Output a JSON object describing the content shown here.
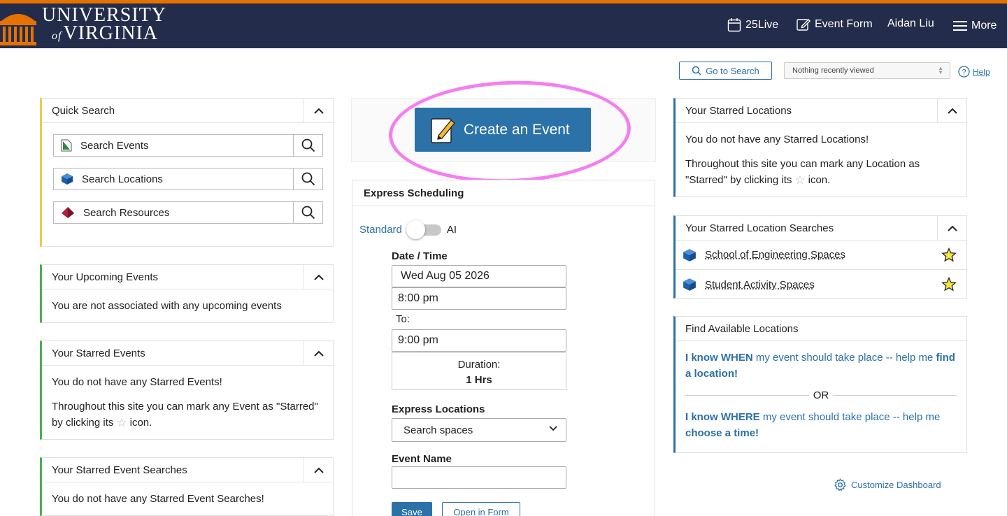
{
  "header": {
    "logo_line1": "UNIVERSITY",
    "logo_of": "of",
    "logo_line2": "VIRGINIA",
    "nav": {
      "live_label": "25Live",
      "event_form_label": "Event Form",
      "user_name": "Aidan Liu",
      "more_label": "More"
    }
  },
  "utility": {
    "go_to_search": "Go to Search",
    "recently_viewed": "Nothing recently viewed",
    "help": "Help"
  },
  "quick_search": {
    "title": "Quick Search",
    "items": [
      {
        "label": "Search Events"
      },
      {
        "label": "Search Locations"
      },
      {
        "label": "Search Resources"
      }
    ]
  },
  "upcoming_events": {
    "title": "Your Upcoming Events",
    "message": "You are not associated with any upcoming events"
  },
  "starred_events": {
    "title": "Your Starred Events",
    "message": "You do not have any Starred Events!",
    "hint_before": "Throughout this site you can mark any Event as \"Starred\" by clicking its",
    "hint_after": "icon."
  },
  "starred_event_searches": {
    "title": "Your Starred Event Searches",
    "message": "You do not have any Starred Event Searches!"
  },
  "create_event": {
    "label": "Create an Event"
  },
  "express": {
    "title": "Express Scheduling",
    "toggle_left": "Standard",
    "toggle_right": "AI",
    "toggle_on": false,
    "date_time_label": "Date / Time",
    "date": "Wed Aug 05 2026",
    "start_time": "8:00 pm",
    "to_label": "To:",
    "end_time": "9:00 pm",
    "duration_label": "Duration:",
    "duration_value": "1 Hrs",
    "locations_label": "Express Locations",
    "locations_value": "Search spaces",
    "event_name_label": "Event Name",
    "event_name_value": "",
    "save": "Save",
    "open_in_form": "Open in Form"
  },
  "starred_locations": {
    "title": "Your Starred Locations",
    "message": "You do not have any Starred Locations!",
    "hint_before": "Throughout this site you can mark any Location as \"Starred\" by clicking its",
    "hint_after": "icon."
  },
  "starred_location_searches": {
    "title": "Your Starred Location Searches",
    "items": [
      {
        "label": "School of Engineering Spaces"
      },
      {
        "label": "Student Activity Spaces"
      }
    ]
  },
  "find_locations": {
    "title": "Find Available Locations",
    "when_bold1": "I know WHEN",
    "when_text": " my event should take place -- help me ",
    "when_bold2": "find a location!",
    "or": "OR",
    "where_bold1": "I know WHERE",
    "where_text": " my event should take place -- help me ",
    "where_bold2": "choose a time!"
  },
  "customize": "Customize Dashboard",
  "colors": {
    "header_bg": "#232d4b",
    "accent_orange": "#e57200",
    "primary_blue": "#2a72a8",
    "highlight_circle": "#f57ef0"
  }
}
